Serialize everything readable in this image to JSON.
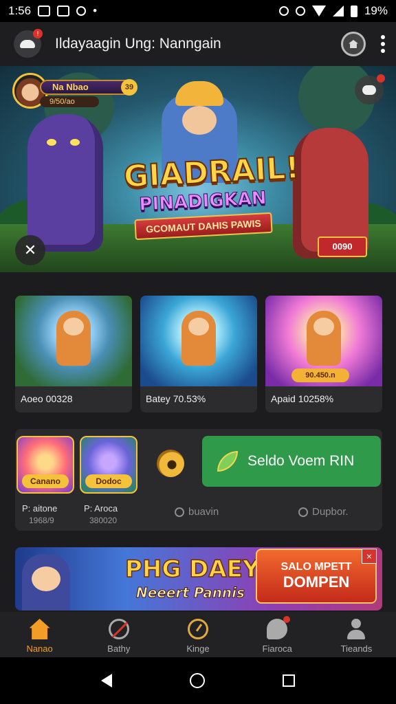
{
  "status_bar": {
    "time": "1:56",
    "battery": "19%"
  },
  "app_bar": {
    "title": "Ildayaagin Ung: Nanngain",
    "notification_badge": "!"
  },
  "hero": {
    "player_name": "Na Nbao",
    "player_gold": "39",
    "player_gems": "9/50/ao",
    "title": "GIADRAIL!",
    "subtitle": "PINADIGKAN",
    "ribbon": "GCOMAUT DAHIS PAWIS",
    "chest_value": "0090"
  },
  "games": [
    {
      "label": "Aoeo 00328",
      "thumb": "thumb-1"
    },
    {
      "label": "Batey 70.53%",
      "thumb": "thumb-2"
    },
    {
      "label": "Apaid 10258%",
      "thumb": "thumb-3",
      "price": "90.450.n"
    }
  ],
  "rewards": {
    "items": [
      {
        "badge": "Canano",
        "name": "P: aitone",
        "value": "1968/9"
      },
      {
        "badge": "Dodoc",
        "name": "P: Aroca",
        "value": "380020"
      }
    ],
    "cta_label": "Seldo Voem RIN",
    "link_left": "buavin",
    "link_right": "Dupbor."
  },
  "promo": {
    "title": "PHG DAEY",
    "subtitle": "Neeert Pannis",
    "cta_line1": "SALO MPETT",
    "cta_line2": "DOMPEN",
    "close": "×"
  },
  "bottom_nav": [
    {
      "label": "Nanao",
      "icon": "home-icon",
      "active": true
    },
    {
      "label": "Bathy",
      "icon": "sword-icon",
      "active": false
    },
    {
      "label": "Kinge",
      "icon": "gauge-icon",
      "active": false
    },
    {
      "label": "Fiaroca",
      "icon": "chat-icon",
      "active": false
    },
    {
      "label": "Tieands",
      "icon": "user-icon",
      "active": false
    }
  ],
  "colors": {
    "accent": "#f39c26",
    "cta_green": "#2f9b4a",
    "badge_red": "#d9342b",
    "gold": "#f5c33b"
  }
}
